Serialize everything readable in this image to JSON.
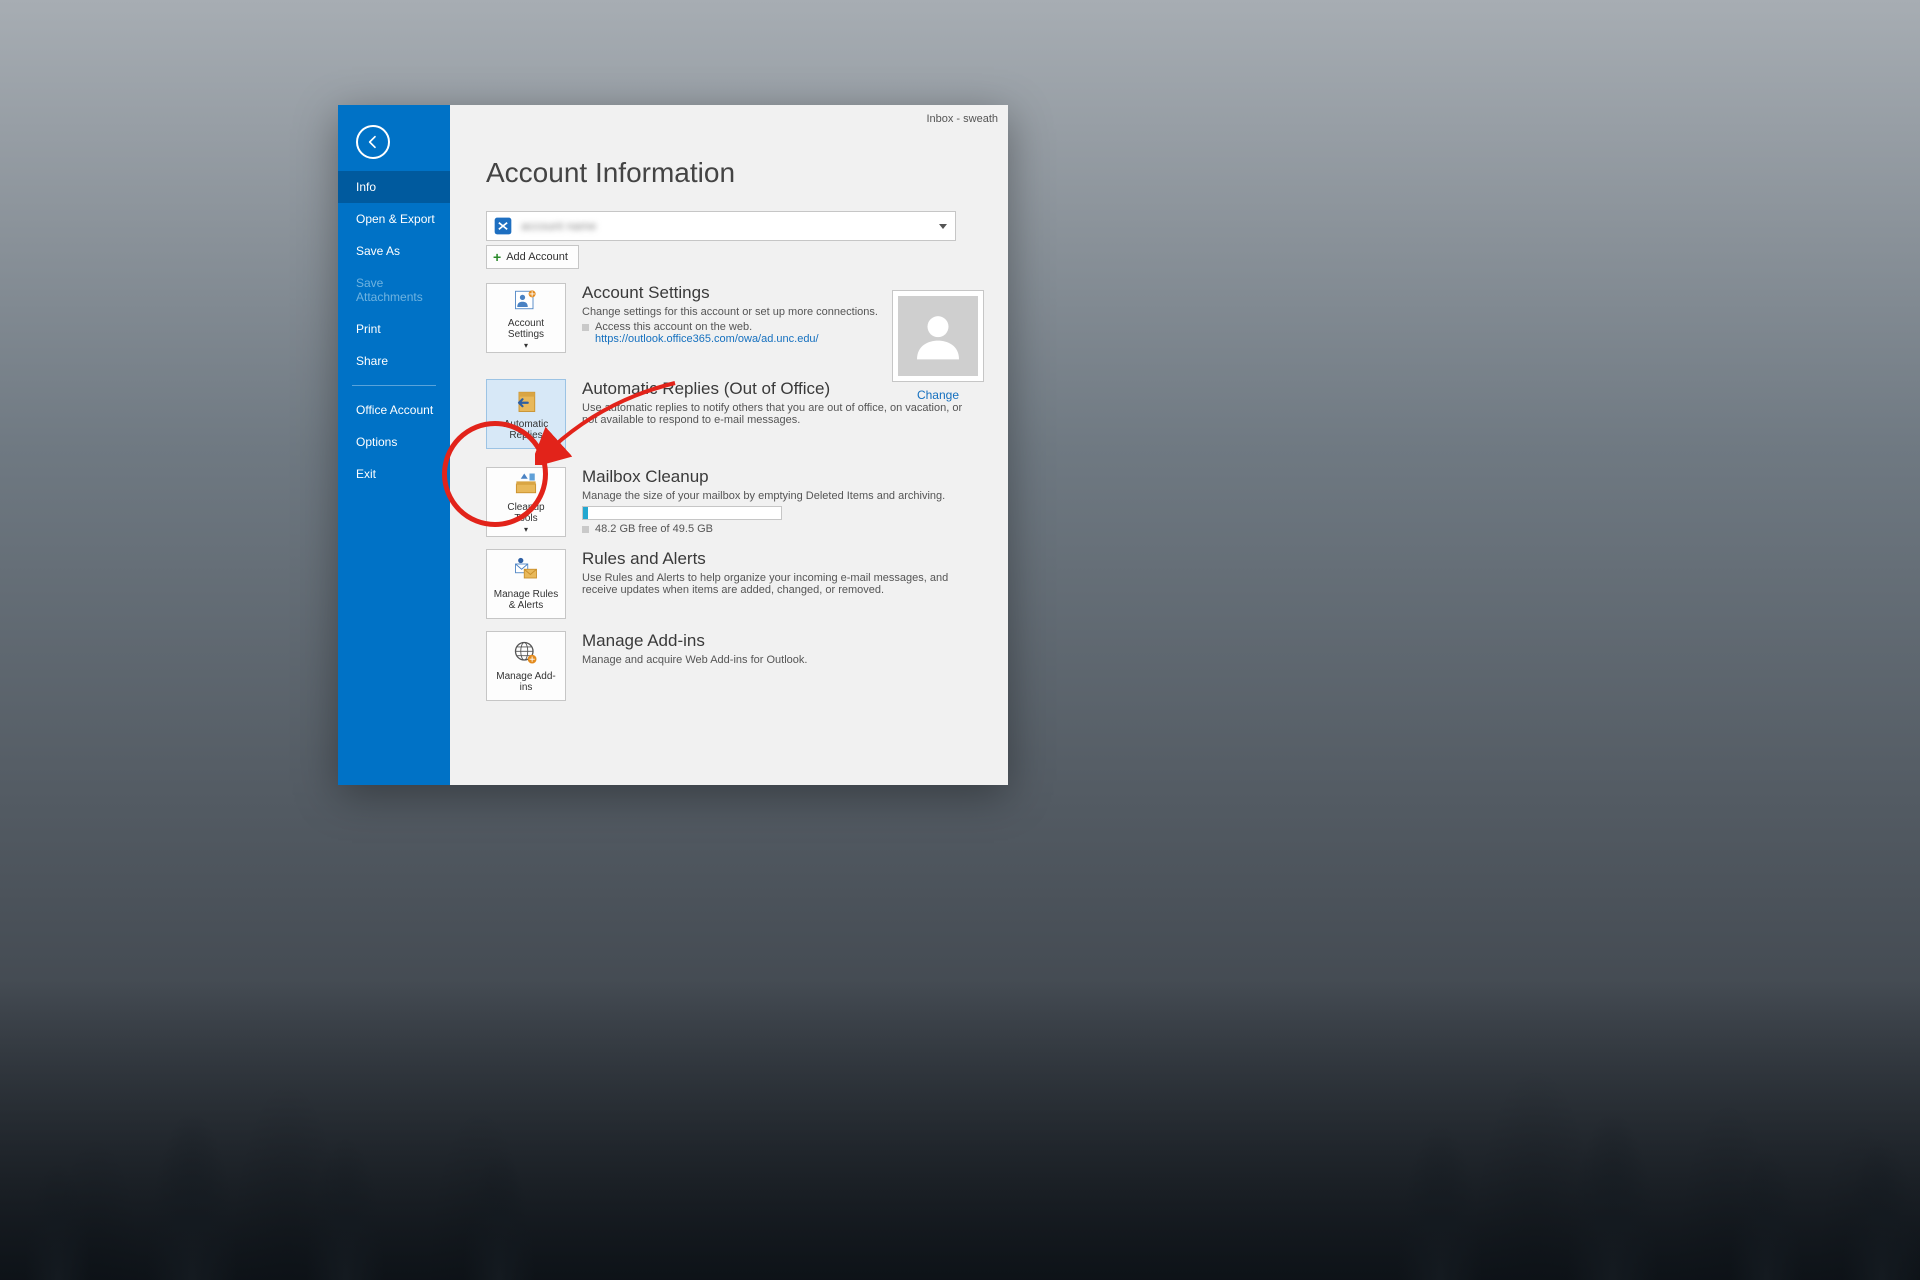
{
  "titlebar": "Inbox - sweath",
  "page_title": "Account Information",
  "sidebar": {
    "items": [
      {
        "label": "Info",
        "state": "selected"
      },
      {
        "label": "Open & Export",
        "state": ""
      },
      {
        "label": "Save As",
        "state": ""
      },
      {
        "label": "Save Attachments",
        "state": "disabled"
      },
      {
        "label": "Print",
        "state": ""
      },
      {
        "label": "Share",
        "state": ""
      }
    ],
    "items2": [
      {
        "label": "Office Account"
      },
      {
        "label": "Options"
      },
      {
        "label": "Exit"
      }
    ]
  },
  "account_dropdown": {
    "blurred_text": "account name"
  },
  "add_account_label": "Add Account",
  "avatar": {
    "change_label": "Change"
  },
  "buttons": {
    "account_settings": "Account\nSettings",
    "automatic_replies": "Automatic\nReplies",
    "cleanup_tools": "Cleanup\nTools",
    "manage_rules": "Manage Rules\n& Alerts",
    "manage_addins": "Manage Add-\nins"
  },
  "sections": {
    "account_settings": {
      "title": "Account Settings",
      "desc": "Change settings for this account or set up more connections.",
      "bullet": "Access this account on the web.",
      "link": "https://outlook.office365.com/owa/ad.unc.edu/"
    },
    "automatic_replies": {
      "title": "Automatic Replies (Out of Office)",
      "desc": "Use automatic replies to notify others that you are out of office, on vacation, or not available to respond to e-mail messages."
    },
    "mailbox_cleanup": {
      "title": "Mailbox Cleanup",
      "desc": "Manage the size of your mailbox by emptying Deleted Items and archiving.",
      "quota": "48.2 GB free of 49.5 GB"
    },
    "rules": {
      "title": "Rules and Alerts",
      "desc": "Use Rules and Alerts to help organize your incoming e-mail messages, and receive updates when items are added, changed, or removed."
    },
    "addins": {
      "title": "Manage Add-ins",
      "desc": "Manage and acquire Web Add-ins for Outlook."
    }
  }
}
